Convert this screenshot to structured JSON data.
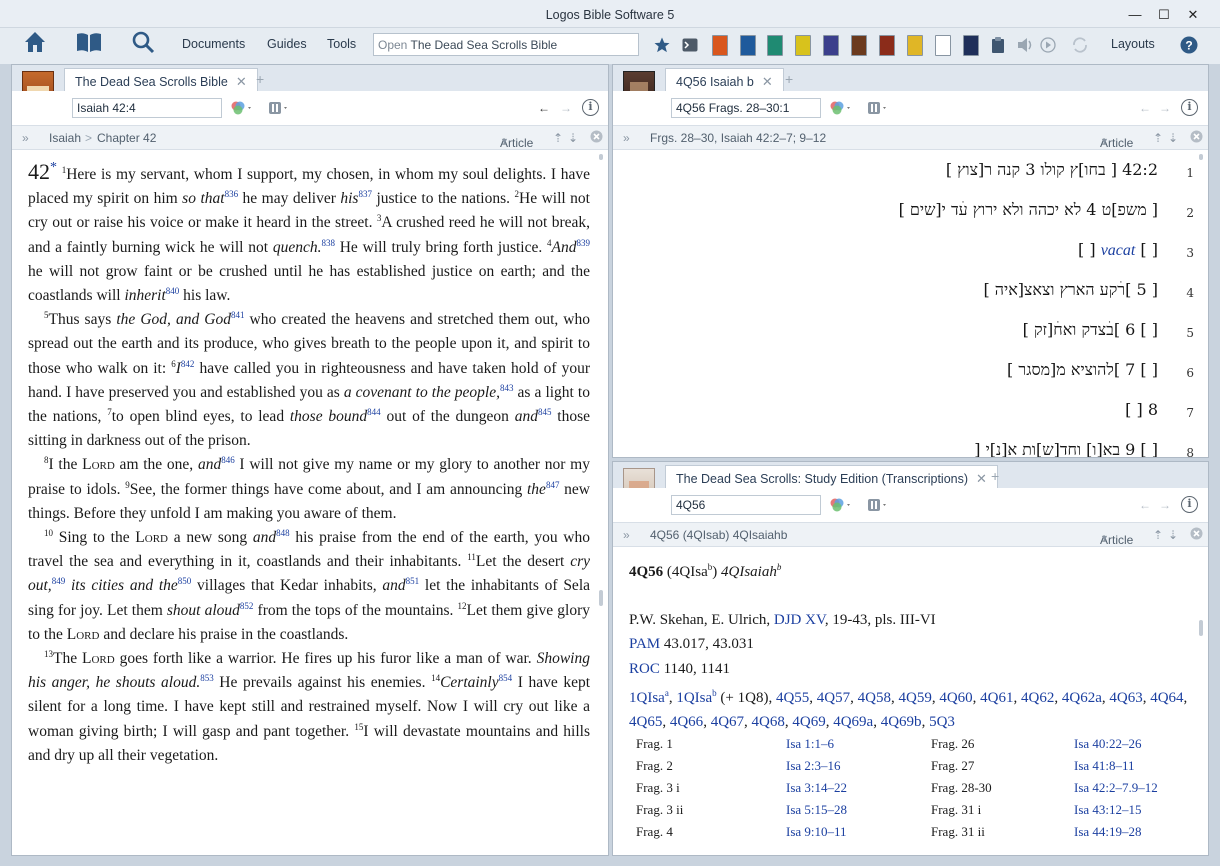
{
  "window": {
    "title": "Logos Bible Software 5"
  },
  "toolbar": {
    "menus": [
      "Documents",
      "Guides",
      "Tools"
    ],
    "search_prefix": "Open",
    "search_text": "The Dead Sea Scrolls Bible",
    "layouts_label": "Layouts",
    "book_colors": [
      "#d9571e",
      "#1f5a9c",
      "#1f8a72",
      "#d8c21c",
      "#3b3f8c",
      "#6b3a1e",
      "#8b2c1a",
      "#e0b626",
      "#ffffff",
      "#1f2f5a"
    ]
  },
  "left_panel": {
    "tab_label": "The Dead Sea Scrolls Bible",
    "reference": "Isaiah 42:4",
    "breadcrumb": [
      "Isaiah",
      "Chapter 42"
    ],
    "mode": "Article",
    "chapter": "42",
    "chapter_mark": "*",
    "paragraphs": [
      [
        {
          "t": "v",
          "s": "1"
        },
        {
          "t": "x",
          "s": "Here is my servant, whom I support, my chosen, in whom my soul delights. I have placed my spirit on him "
        },
        {
          "t": "i",
          "s": "so that"
        },
        {
          "t": "f",
          "s": "836"
        },
        {
          "t": "x",
          "s": " he may deliver "
        },
        {
          "t": "i",
          "s": "his"
        },
        {
          "t": "f",
          "s": "837"
        },
        {
          "t": "x",
          "s": " justice to the nations. "
        },
        {
          "t": "v",
          "s": "2"
        },
        {
          "t": "x",
          "s": "He will not cry out or raise his voice or make it heard in the street. "
        },
        {
          "t": "v",
          "s": "3"
        },
        {
          "t": "x",
          "s": "A crushed reed he will not break, and a faintly burning wick he will not "
        },
        {
          "t": "i",
          "s": "quench."
        },
        {
          "t": "f",
          "s": "838"
        },
        {
          "t": "x",
          "s": " He will truly bring forth justice. "
        },
        {
          "t": "v",
          "s": "4"
        },
        {
          "t": "i",
          "s": "And"
        },
        {
          "t": "f",
          "s": "839"
        },
        {
          "t": "x",
          "s": " he will not grow faint or be crushed until he has established justice on earth; and the coastlands will "
        },
        {
          "t": "i",
          "s": "inherit"
        },
        {
          "t": "f",
          "s": "840"
        },
        {
          "t": "x",
          "s": " his law."
        }
      ],
      [
        {
          "t": "v",
          "s": "5"
        },
        {
          "t": "x",
          "s": "Thus says "
        },
        {
          "t": "i",
          "s": "the God, and God"
        },
        {
          "t": "f",
          "s": "841"
        },
        {
          "t": "x",
          "s": " who created the heavens and stretched them out, who spread out the earth and its produce, who gives breath to the people upon it, and spirit to those who walk on it: "
        },
        {
          "t": "v",
          "s": "6"
        },
        {
          "t": "i",
          "s": "I"
        },
        {
          "t": "f",
          "s": "842"
        },
        {
          "t": "x",
          "s": " have called you in righteous­ness and have taken hold of your hand. I have preserved you and established you as "
        },
        {
          "t": "i",
          "s": "a covenant to the people,"
        },
        {
          "t": "f",
          "s": "843"
        },
        {
          "t": "x",
          "s": " as a light to the nations, "
        },
        {
          "t": "v",
          "s": "7"
        },
        {
          "t": "x",
          "s": "to open blind eyes, to lead "
        },
        {
          "t": "i",
          "s": "those bound"
        },
        {
          "t": "f",
          "s": "844"
        },
        {
          "t": "x",
          "s": " out of the dungeon "
        },
        {
          "t": "i",
          "s": "and"
        },
        {
          "t": "f",
          "s": "845"
        },
        {
          "t": "x",
          "s": " those sitting in darkness out of the prison."
        }
      ],
      [
        {
          "t": "v",
          "s": "8"
        },
        {
          "t": "x",
          "s": "I the "
        },
        {
          "t": "c",
          "s": "Lord"
        },
        {
          "t": "x",
          "s": " am the one, "
        },
        {
          "t": "i",
          "s": "and"
        },
        {
          "t": "f",
          "s": "846"
        },
        {
          "t": "x",
          "s": " I will not give my name or my glory to another nor my praise to idols. "
        },
        {
          "t": "v",
          "s": "9"
        },
        {
          "t": "x",
          "s": "See, the former things have come about, and I am announcing "
        },
        {
          "t": "i",
          "s": "the"
        },
        {
          "t": "f",
          "s": "847"
        },
        {
          "t": "x",
          "s": " new things. Before they unfold I am making you aware of them."
        }
      ],
      [
        {
          "t": "v",
          "s": "10"
        },
        {
          "t": "x",
          "s": " Sing to the "
        },
        {
          "t": "c",
          "s": "Lord"
        },
        {
          "t": "x",
          "s": " a new song "
        },
        {
          "t": "i",
          "s": "and"
        },
        {
          "t": "f",
          "s": "848"
        },
        {
          "t": "x",
          "s": " his praise from the end of the earth, you who travel the sea and everything in it, coastlands and their inhabitants. "
        },
        {
          "t": "v",
          "s": "11"
        },
        {
          "t": "x",
          "s": "Let the desert "
        },
        {
          "t": "i",
          "s": "cry out,"
        },
        {
          "t": "f",
          "s": "849"
        },
        {
          "t": "x",
          "s": " "
        },
        {
          "t": "i",
          "s": "its cities and the"
        },
        {
          "t": "f",
          "s": "850"
        },
        {
          "t": "x",
          "s": " villages that Kedar inhabits, "
        },
        {
          "t": "i",
          "s": "and"
        },
        {
          "t": "f",
          "s": "851"
        },
        {
          "t": "x",
          "s": " let the inhabitants of Sela sing for joy. Let them "
        },
        {
          "t": "i",
          "s": "shout aloud"
        },
        {
          "t": "f",
          "s": "852"
        },
        {
          "t": "x",
          "s": " from the tops of the mountains. "
        },
        {
          "t": "v",
          "s": "12"
        },
        {
          "t": "x",
          "s": "Let them give glory to the "
        },
        {
          "t": "c",
          "s": "Lord"
        },
        {
          "t": "x",
          "s": " and declare his praise in the coastlands."
        }
      ],
      [
        {
          "t": "v",
          "s": "13"
        },
        {
          "t": "x",
          "s": "The "
        },
        {
          "t": "c",
          "s": "Lord"
        },
        {
          "t": "x",
          "s": " goes forth like a warrior. He fires up his furor like a man of war. "
        },
        {
          "t": "i",
          "s": "Showing his anger, he shouts aloud."
        },
        {
          "t": "f",
          "s": "853"
        },
        {
          "t": "x",
          "s": " He prevails against his enemies. "
        },
        {
          "t": "v",
          "s": "14"
        },
        {
          "t": "i",
          "s": "Certainly"
        },
        {
          "t": "f",
          "s": "854"
        },
        {
          "t": "x",
          "s": " I have kept silent for a long time. I have kept still and restrained myself. Now I will cry out like a woman giving birth; I will gasp and pant together. "
        },
        {
          "t": "v",
          "s": "15"
        },
        {
          "t": "x",
          "s": "I will devastate mountains and hills and dry up all their vegetation."
        }
      ]
    ]
  },
  "right_top_panel": {
    "tab_label": "4Q56 Isaiah b",
    "reference": "4Q56 Frags. 28–30:1",
    "breadcrumb": "Frgs. 28–30, Isaiah 42:2–7; 9–12",
    "mode": "Article",
    "lines": [
      {
        "num": "1",
        "text": "42:2  [ בחו]ץ קולו 3 קנה ר[צוץ ]"
      },
      {
        "num": "2",
        "text": "[ משפ]ט 4 לא יכהה ולא ירוץ עׄד י[שים ]"
      },
      {
        "num": "3",
        "text": "[ ]  vacat  [ ]"
      },
      {
        "num": "4",
        "text": "[ 5 ]רׄקע הארץ וצאצ[איה ]"
      },
      {
        "num": "5",
        "text": "[ ] 6 ]בׄצדק ואחׄ[זק ]"
      },
      {
        "num": "6",
        "text": "[ ] 7 ]להוציא מ[מסגר ]"
      },
      {
        "num": "7",
        "text": "[ ] 8"
      },
      {
        "num": "8",
        "text": "[ ] 9 בא[ו] וחד[ש]ות א[נ]י ["
      }
    ]
  },
  "right_bottom_panel": {
    "tab_label": "The Dead Sea Scrolls: Study Edition (Transcriptions)",
    "reference": "4Q56",
    "breadcrumb": "4Q56 (4QIsab) 4QIsaiahb",
    "mode": "Article",
    "heading_id": "4Q56",
    "heading_alt": "(4QIsa",
    "heading_alt_sup": "b",
    "heading_alt_close": ")",
    "heading_name": "4QIsaiah",
    "heading_name_sup": "b",
    "editors_prefix": "P.W. Skehan, E. Ulrich, ",
    "editors_link": "DJD XV",
    "editors_suffix": ", 19-43, pls. III-VI",
    "pam_link": "PAM",
    "pam_text": " 43.017, 43.031",
    "roc_link": "ROC",
    "roc_text": " 1140, 1141",
    "related_links": [
      "1QIsa",
      "1QIsa"
    ],
    "related_sups": [
      "a",
      "b"
    ],
    "related_mid": " (+ 1Q8), ",
    "related_more": [
      "4Q55",
      "4Q57",
      "4Q58",
      "4Q59",
      "4Q60",
      "4Q61",
      "4Q62",
      "4Q62a",
      "4Q63",
      "4Q64",
      "4Q65",
      "4Q66",
      "4Q67",
      "4Q68",
      "4Q69",
      "4Q69a",
      "4Q69b",
      "5Q3"
    ],
    "fragments": [
      {
        "frag": "Frag. 1",
        "ref": "Isa 1:1–6",
        "frag2": "Frag. 26",
        "ref2": "Isa 40:22–26"
      },
      {
        "frag": "Frag. 2",
        "ref": "Isa 2:3–16",
        "frag2": "Frag. 27",
        "ref2": "Isa 41:8–11"
      },
      {
        "frag": "Frag. 3 i",
        "ref": "Isa 3:14–22",
        "frag2": "Frag. 28-30",
        "ref2": "Isa 42:2–7.9–12"
      },
      {
        "frag": "Frag. 3 ii",
        "ref": "Isa 5:15–28",
        "frag2": "Frag. 31 i",
        "ref2": "Isa 43:12–15"
      },
      {
        "frag": "Frag. 4",
        "ref": "Isa 9:10–11",
        "frag2": "Frag. 31 ii",
        "ref2": "Isa 44:19–28"
      }
    ]
  }
}
